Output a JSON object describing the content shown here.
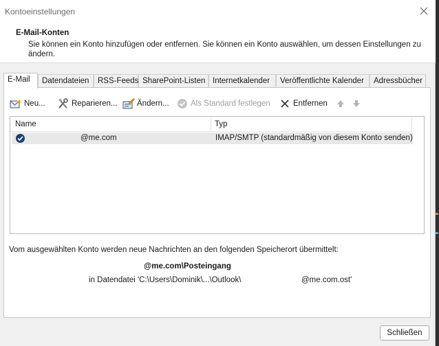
{
  "window": {
    "title": "Kontoeinstellungen"
  },
  "header": {
    "title": "E-Mail-Konten",
    "description": "Sie können ein Konto hinzufügen oder entfernen. Sie können ein Konto auswählen, um dessen Einstellungen zu ändern."
  },
  "tabs": [
    {
      "label": "E-Mail",
      "active": true
    },
    {
      "label": "Datendateien"
    },
    {
      "label": "RSS-Feeds"
    },
    {
      "label": "SharePoint-Listen"
    },
    {
      "label": "Internetkalender"
    },
    {
      "label": "Veröffentlichte Kalender"
    },
    {
      "label": "Adressbücher"
    }
  ],
  "toolbar": {
    "new_label": "Neu...",
    "repair_label": "Reparieren...",
    "change_label": "Ändern...",
    "set_default_label": "Als Standard festlegen",
    "remove_label": "Entfernen"
  },
  "list": {
    "col_name": "Name",
    "col_type": "Typ",
    "rows": [
      {
        "name": "@me.com",
        "type": "IMAP/SMTP (standardmäßig von diesem Konto senden)"
      }
    ]
  },
  "delivery": {
    "info": "Vom ausgewählten Konto werden neue Nachrichten an den folgenden Speicherort übermittelt:",
    "store": "@me.com\\Posteingang",
    "datafile_prefix": "in Datendatei 'C:\\Users\\Dominik\\...\\Outlook\\",
    "datafile_suffix": "@me.com.ost'"
  },
  "footer": {
    "close_label": "Schließen"
  },
  "colors": {
    "accent": "#1a3f73",
    "window_bg": "#f0f0f0",
    "selected_row": "#e8e8e8"
  }
}
